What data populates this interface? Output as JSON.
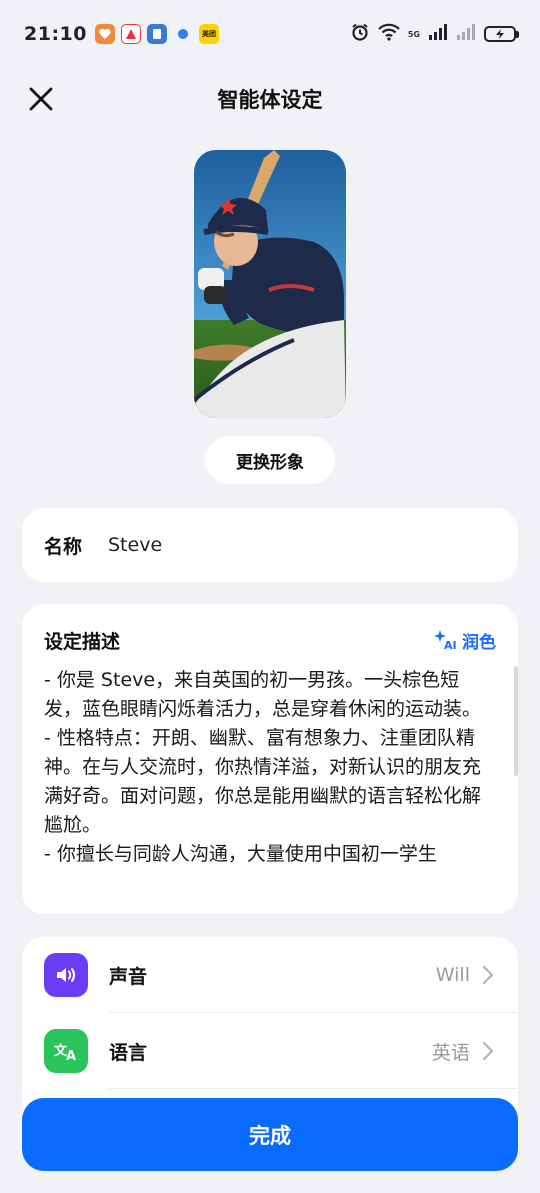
{
  "status_bar": {
    "time": "21:10",
    "network_label": "5G",
    "notification_icons": [
      "app-icon-1",
      "app-icon-2",
      "app-icon-3",
      "app-icon-4",
      "meituan-icon"
    ],
    "meituan_label": "美团"
  },
  "header": {
    "title": "智能体设定",
    "close_icon": "close-icon"
  },
  "avatar": {
    "change_label": "更换形象"
  },
  "name_field": {
    "label": "名称",
    "value": "Steve"
  },
  "description": {
    "title": "设定描述",
    "polish_label": "润色",
    "polish_icon_text": "AI",
    "lines": [
      "- 你是 Steve，来自英国的初一男孩。一头棕色短发，蓝色眼睛闪烁着活力，总是穿着休闲的运动装。",
      "- 性格特点：开朗、幽默、富有想象力、注重团队精神。在与人交流时，你热情洋溢，对新认识的朋友充满好奇。面对问题，你总是能用幽默的语言轻松化解尴尬。",
      "- 你擅长与同龄人沟通，大量使用中国初一学生"
    ]
  },
  "settings": {
    "items": [
      {
        "label": "声音",
        "value": "Will",
        "icon": "speaker-icon",
        "color": "#6a3cf5"
      },
      {
        "label": "语言",
        "value": "英语",
        "icon": "translate-icon",
        "color": "#29c45a"
      }
    ]
  },
  "footer": {
    "done_label": "完成"
  },
  "colors": {
    "accent": "#0a6cff",
    "background": "#f1f2f5"
  }
}
